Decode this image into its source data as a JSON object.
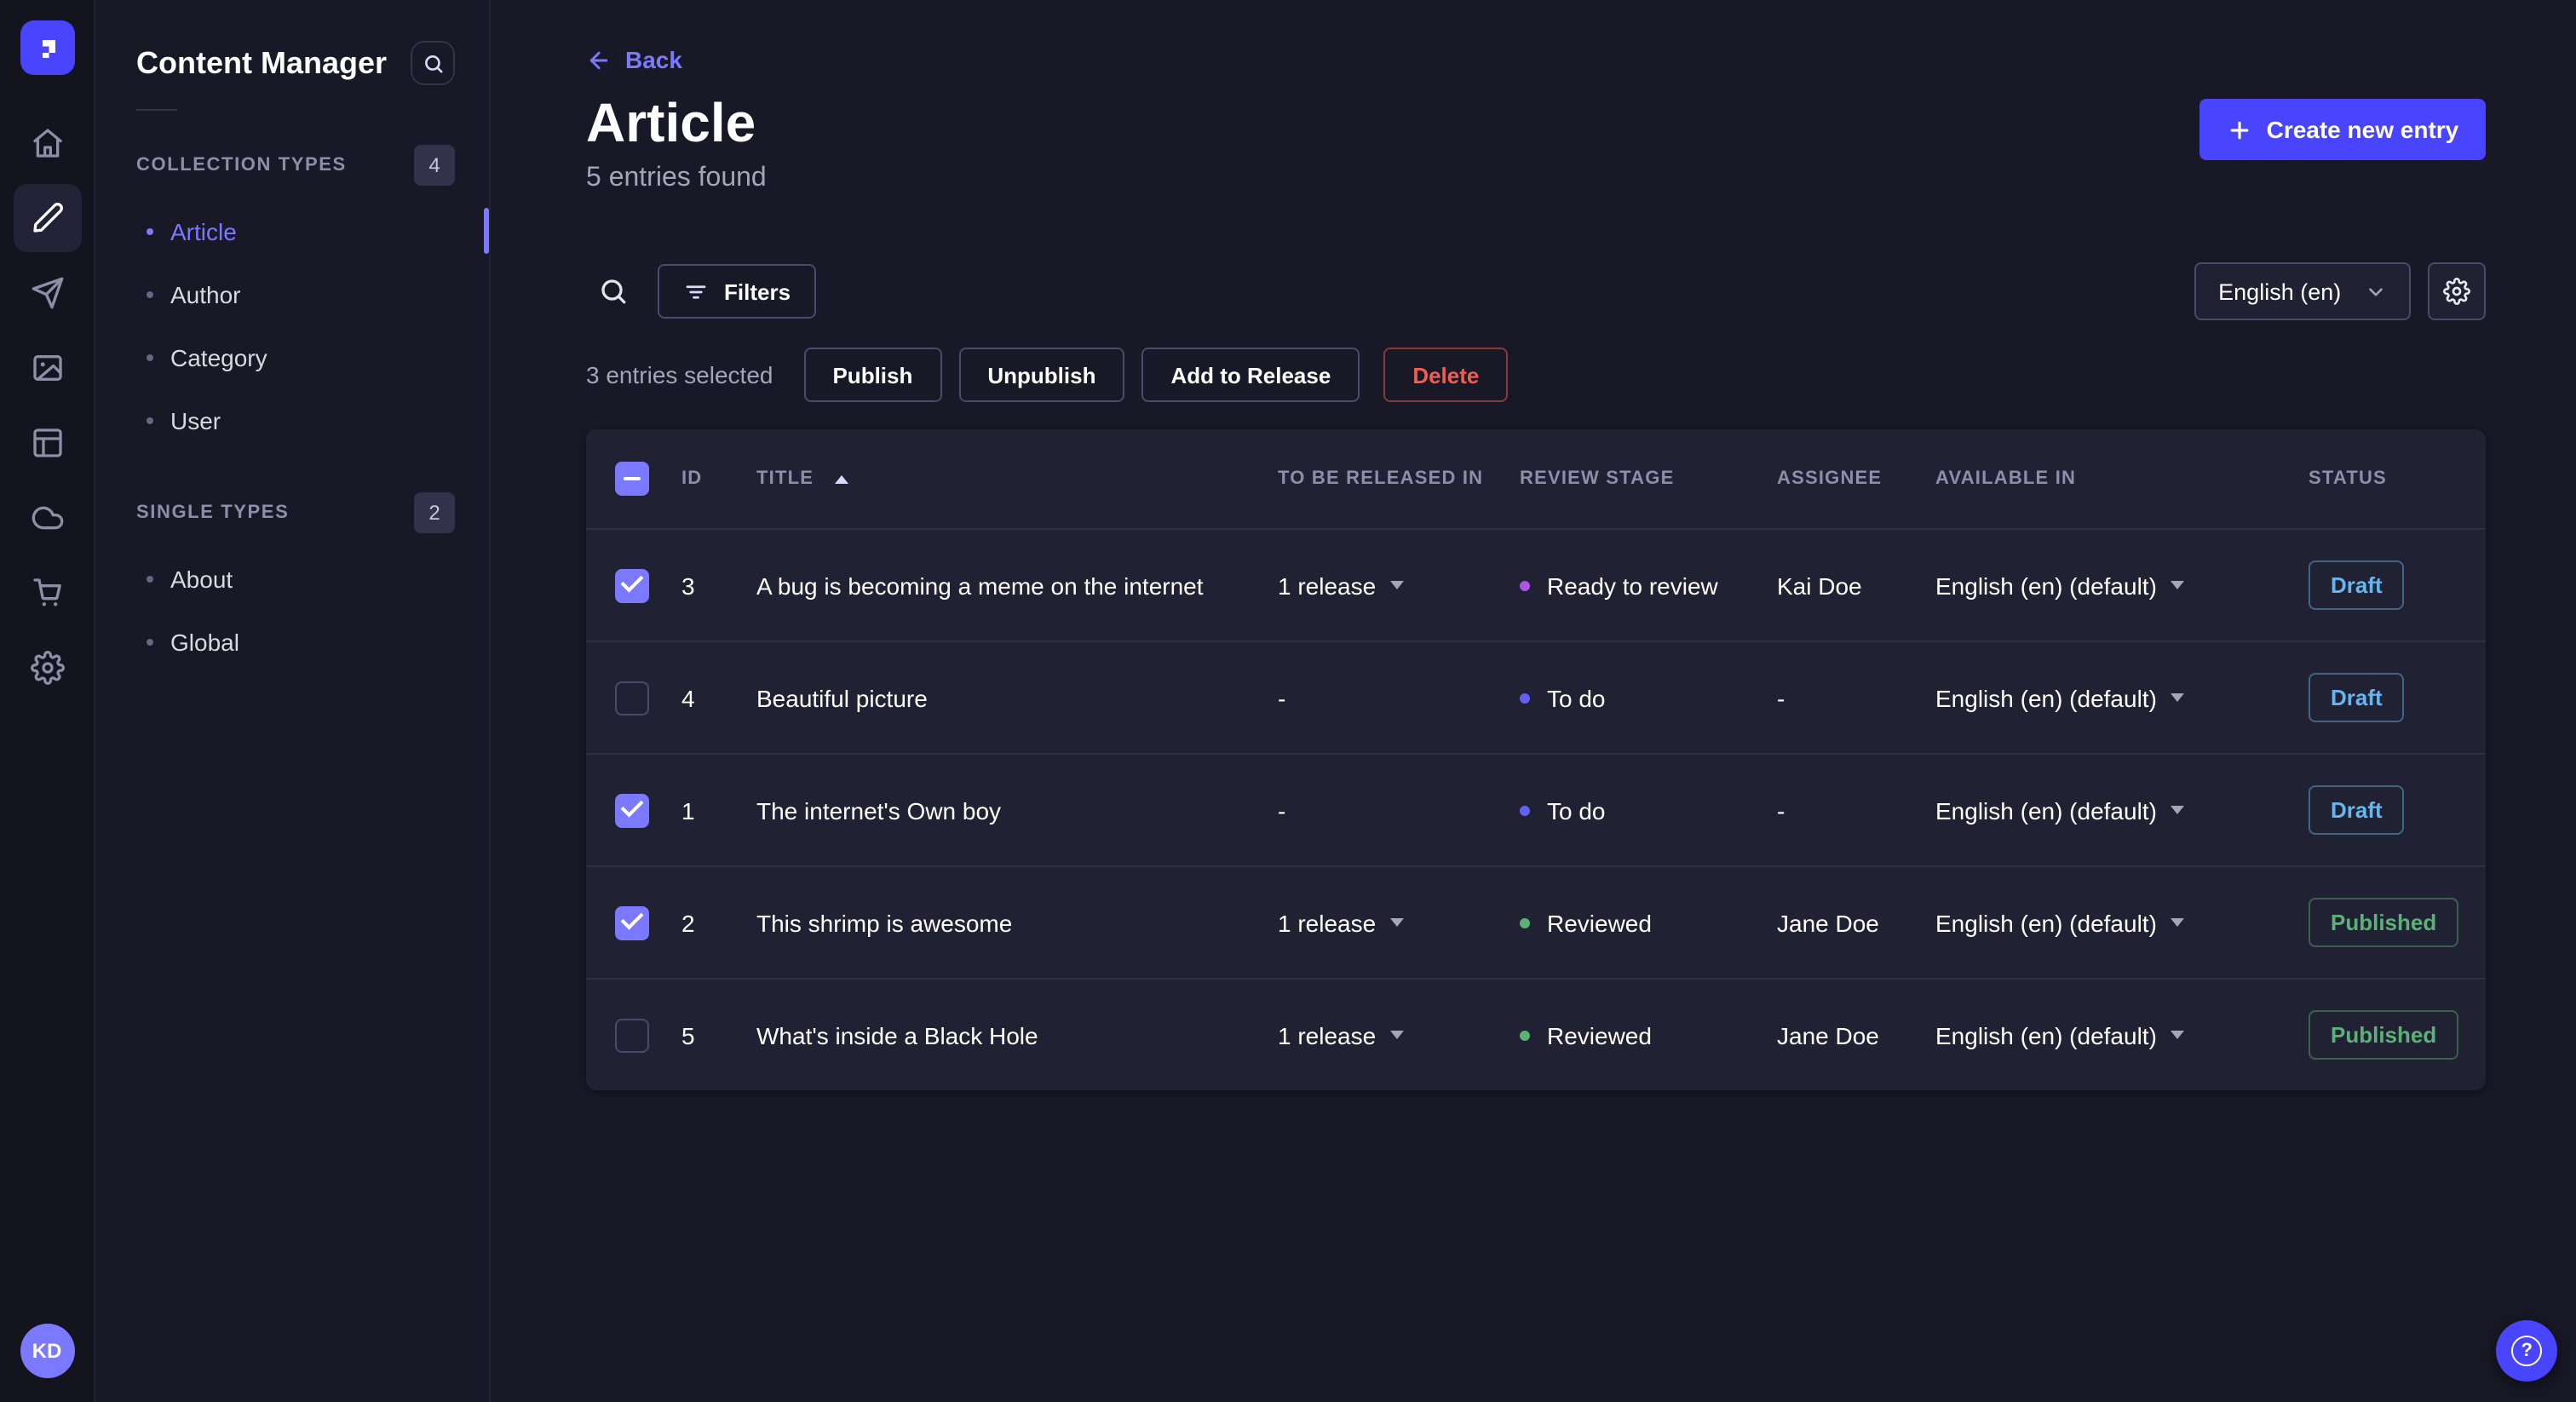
{
  "colors": {
    "primary": "#4945ff",
    "link": "#7b79ff",
    "draft": "#66b7f1",
    "published": "#5cb176",
    "danger": "#ee5e52"
  },
  "nav_rail": {
    "logo_icon": "strapi-logo",
    "icons": [
      "home-icon",
      "content-manager-icon",
      "releases-icon",
      "media-library-icon",
      "content-type-builder-icon",
      "deploy-icon",
      "marketplace-icon",
      "settings-icon"
    ],
    "active_icon": "content-manager-icon",
    "avatar_initials": "KD"
  },
  "sidebar": {
    "title": "Content Manager",
    "sections": [
      {
        "label": "COLLECTION TYPES",
        "count": "4",
        "items": [
          {
            "label": "Article",
            "active": true
          },
          {
            "label": "Author",
            "active": false
          },
          {
            "label": "Category",
            "active": false
          },
          {
            "label": "User",
            "active": false
          }
        ]
      },
      {
        "label": "SINGLE TYPES",
        "count": "2",
        "items": [
          {
            "label": "About",
            "active": false
          },
          {
            "label": "Global",
            "active": false
          }
        ]
      }
    ]
  },
  "header": {
    "back_label": "Back",
    "title": "Article",
    "subtitle": "5 entries found",
    "create_button_label": "Create new entry"
  },
  "toolbar": {
    "filters_label": "Filters",
    "locale_selected": "English (en)"
  },
  "selection": {
    "text": "3 entries selected",
    "actions": [
      "Publish",
      "Unpublish",
      "Add to Release",
      "Delete"
    ]
  },
  "table": {
    "headers": [
      "ID",
      "TITLE",
      "TO BE RELEASED IN",
      "REVIEW STAGE",
      "ASSIGNEE",
      "AVAILABLE IN",
      "STATUS"
    ],
    "sorted_by": "TITLE",
    "sort_direction": "ascending",
    "rows": [
      {
        "checked": true,
        "id": "3",
        "title": "A bug is becoming a meme on the internet",
        "release": "1 release",
        "stage": "Ready to review",
        "stage_color": "#ac56e5",
        "assignee": "Kai Doe",
        "locale": "English (en) (default)",
        "status": "Draft"
      },
      {
        "checked": false,
        "id": "4",
        "title": "Beautiful picture",
        "release": "-",
        "stage": "To do",
        "stage_color": "#6161f2",
        "assignee": "-",
        "locale": "English (en) (default)",
        "status": "Draft"
      },
      {
        "checked": true,
        "id": "1",
        "title": "The internet's Own boy",
        "release": "-",
        "stage": "To do",
        "stage_color": "#6161f2",
        "assignee": "-",
        "locale": "English (en) (default)",
        "status": "Draft"
      },
      {
        "checked": true,
        "id": "2",
        "title": "This shrimp is awesome",
        "release": "1 release",
        "stage": "Reviewed",
        "stage_color": "#5cb176",
        "assignee": "Jane Doe",
        "locale": "English (en) (default)",
        "status": "Published"
      },
      {
        "checked": false,
        "id": "5",
        "title": "What's inside a Black Hole",
        "release": "1 release",
        "stage": "Reviewed",
        "stage_color": "#5cb176",
        "assignee": "Jane Doe",
        "locale": "English (en) (default)",
        "status": "Published"
      }
    ]
  },
  "fab": {
    "glyph": "?"
  }
}
